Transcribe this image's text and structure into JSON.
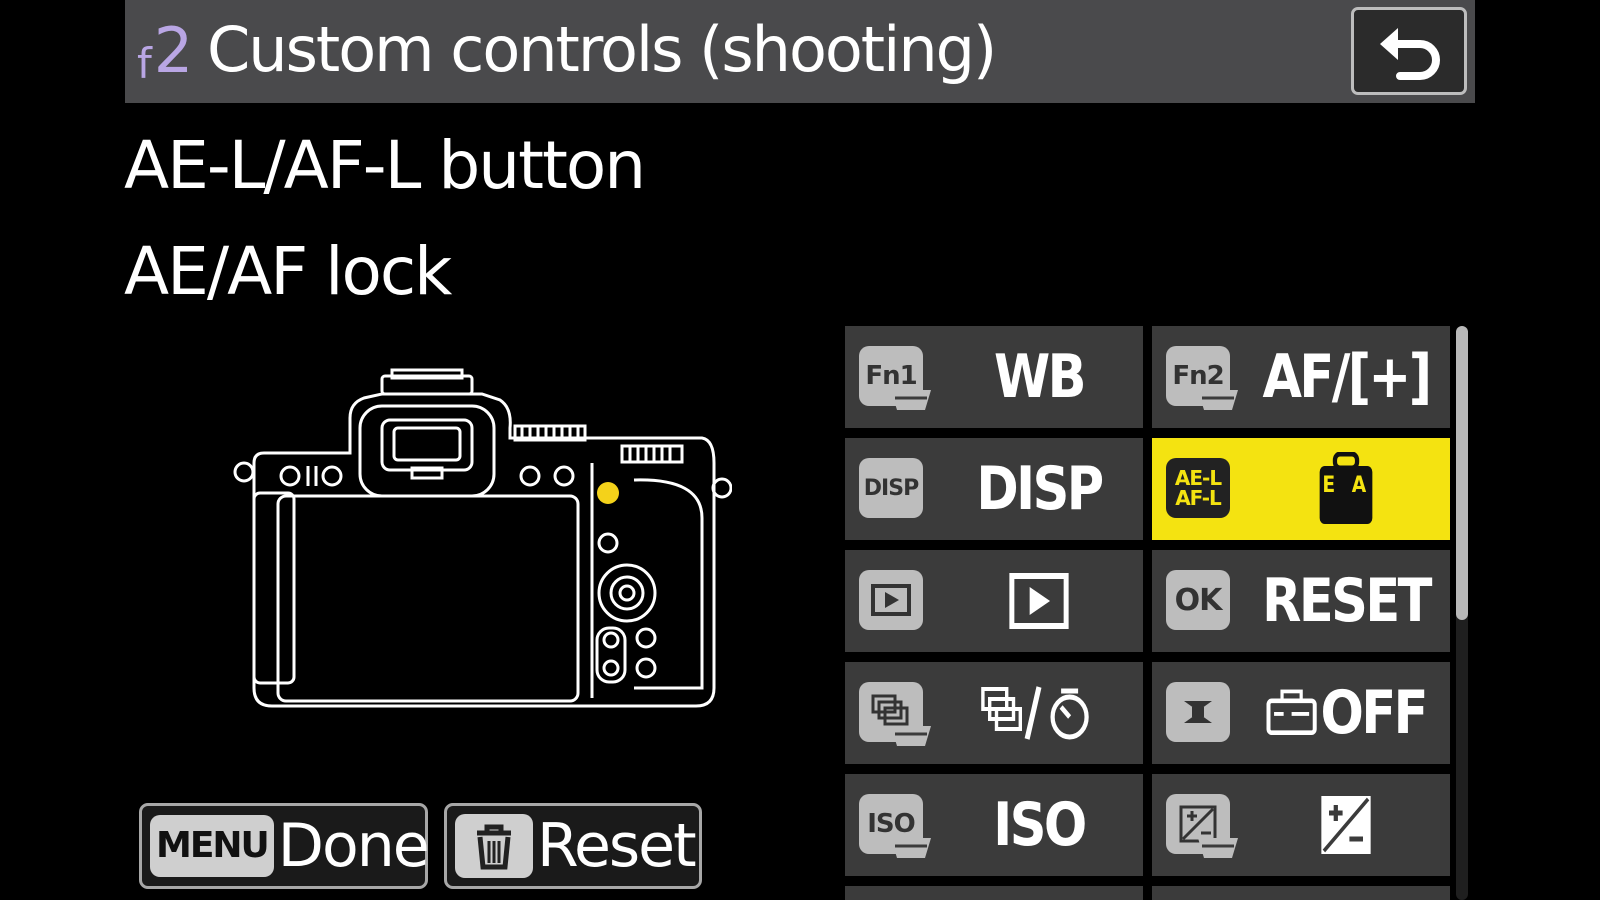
{
  "header": {
    "code_small": "f",
    "code_num": "2",
    "title": "Custom controls (shooting)",
    "back_icon": "return-arrow-icon"
  },
  "subtitle": "AE-L/AF-L button",
  "current_setting": "AE/AF lock",
  "grid": [
    {
      "key": "Fn1",
      "value": "WB"
    },
    {
      "key": "Fn2",
      "value": "AF/[+]"
    },
    {
      "key": "DISP",
      "value": "DISP"
    },
    {
      "key": "AE-L AF-L",
      "value": "AE AF",
      "selected": true
    },
    {
      "key": "playback",
      "value": "playback"
    },
    {
      "key": "OK",
      "value": "RESET"
    },
    {
      "key": "release-mode",
      "value": "release-mode"
    },
    {
      "key": "movie-record",
      "value": "OFF"
    },
    {
      "key": "ISO",
      "value": "ISO"
    },
    {
      "key": "exposure-comp",
      "value": "exposure-comp"
    }
  ],
  "footer": {
    "menu_key": "MENU",
    "done_label": "Done",
    "reset_label": "Reset"
  },
  "colors": {
    "selected": "#f4e311",
    "cell": "#3b3b3b",
    "title_bar": "#4a4a4c",
    "code_purple": "#b9a6e4",
    "indicator_dot": "#f4d21a"
  }
}
